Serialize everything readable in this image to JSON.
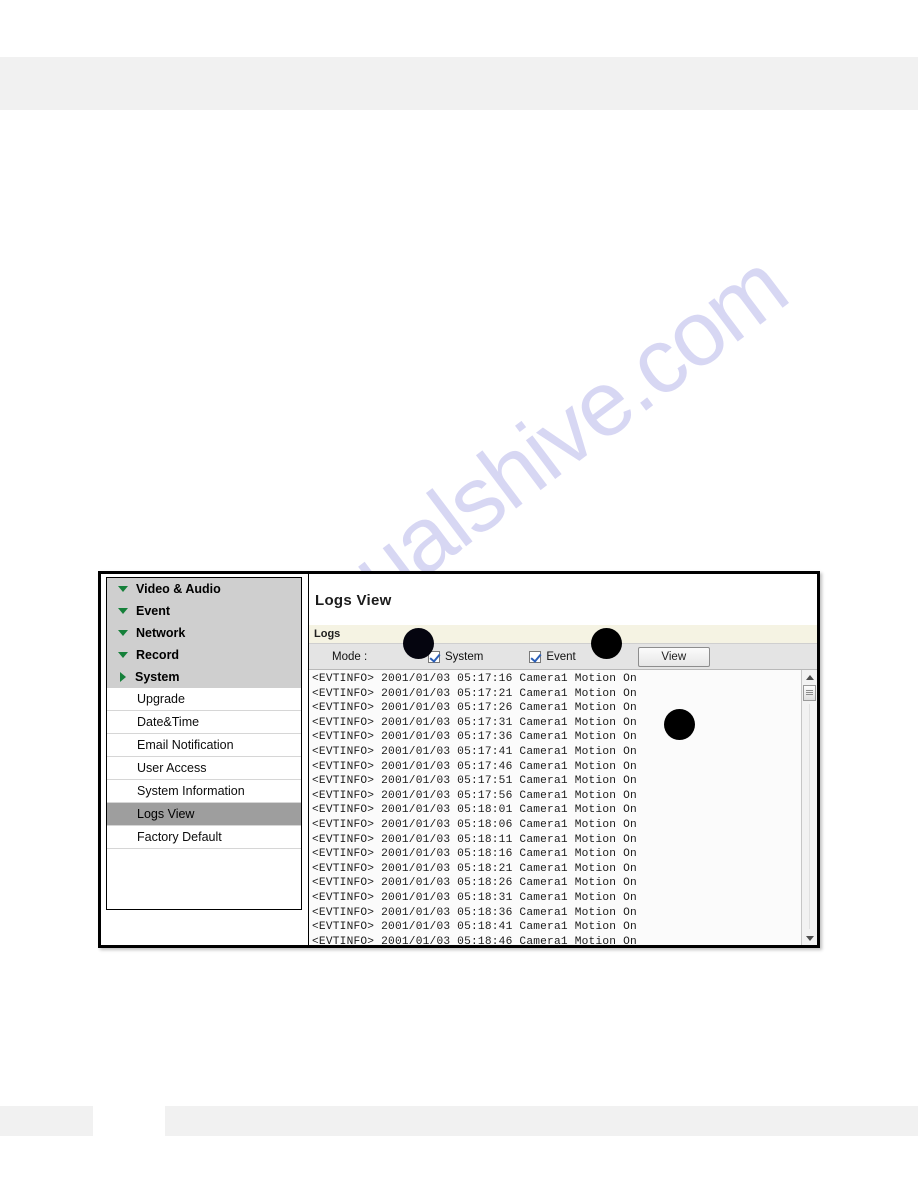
{
  "watermark": {
    "text": "manualshive.com"
  },
  "figure": {
    "nav": {
      "top_items": [
        {
          "label": "Video & Audio",
          "icon": "triangle-down-icon",
          "expanded": false
        },
        {
          "label": "Event",
          "icon": "triangle-down-icon",
          "expanded": false
        },
        {
          "label": "Network",
          "icon": "triangle-down-icon",
          "expanded": false
        },
        {
          "label": "Record",
          "icon": "triangle-down-icon",
          "expanded": false
        },
        {
          "label": "System",
          "icon": "triangle-right-icon",
          "expanded": true
        }
      ],
      "sub_items": [
        {
          "label": "Upgrade",
          "selected": false
        },
        {
          "label": "Date&Time",
          "selected": false
        },
        {
          "label": "Email Notification",
          "selected": false
        },
        {
          "label": "User Access",
          "selected": false
        },
        {
          "label": "System Information",
          "selected": false
        },
        {
          "label": "Logs View",
          "selected": true
        },
        {
          "label": "Factory Default",
          "selected": false
        }
      ]
    },
    "content": {
      "title": "Logs View",
      "group_label": "Logs",
      "mode_label": "Mode :",
      "checkboxes": [
        {
          "label": "System",
          "checked": true
        },
        {
          "label": "Event",
          "checked": true
        }
      ],
      "view_button": "View",
      "log_lines": [
        "<EVTINFO> 2001/01/03 05:17:16 Camera1 Motion On",
        "<EVTINFO> 2001/01/03 05:17:21 Camera1 Motion On",
        "<EVTINFO> 2001/01/03 05:17:26 Camera1 Motion On",
        "<EVTINFO> 2001/01/03 05:17:31 Camera1 Motion On",
        "<EVTINFO> 2001/01/03 05:17:36 Camera1 Motion On",
        "<EVTINFO> 2001/01/03 05:17:41 Camera1 Motion On",
        "<EVTINFO> 2001/01/03 05:17:46 Camera1 Motion On",
        "<EVTINFO> 2001/01/03 05:17:51 Camera1 Motion On",
        "<EVTINFO> 2001/01/03 05:17:56 Camera1 Motion On",
        "<EVTINFO> 2001/01/03 05:18:01 Camera1 Motion On",
        "<EVTINFO> 2001/01/03 05:18:06 Camera1 Motion On",
        "<EVTINFO> 2001/01/03 05:18:11 Camera1 Motion On",
        "<EVTINFO> 2001/01/03 05:18:16 Camera1 Motion On",
        "<EVTINFO> 2001/01/03 05:18:21 Camera1 Motion On",
        "<EVTINFO> 2001/01/03 05:18:26 Camera1 Motion On",
        "<EVTINFO> 2001/01/03 05:18:31 Camera1 Motion On",
        "<EVTINFO> 2001/01/03 05:18:36 Camera1 Motion On",
        "<EVTINFO> 2001/01/03 05:18:41 Camera1 Motion On",
        "<EVTINFO> 2001/01/03 05:18:46 Camera1 Motion On"
      ]
    }
  },
  "colors": {
    "accent_green": "#15803a",
    "selected_gray": "#9e9e9e",
    "nav_group_gray": "#cfcfcf",
    "band_gray": "#f1f1f1",
    "logs_band": "#f5f3e3",
    "marker_black": "#000000",
    "watermark_purple": "#c9c8ef"
  }
}
